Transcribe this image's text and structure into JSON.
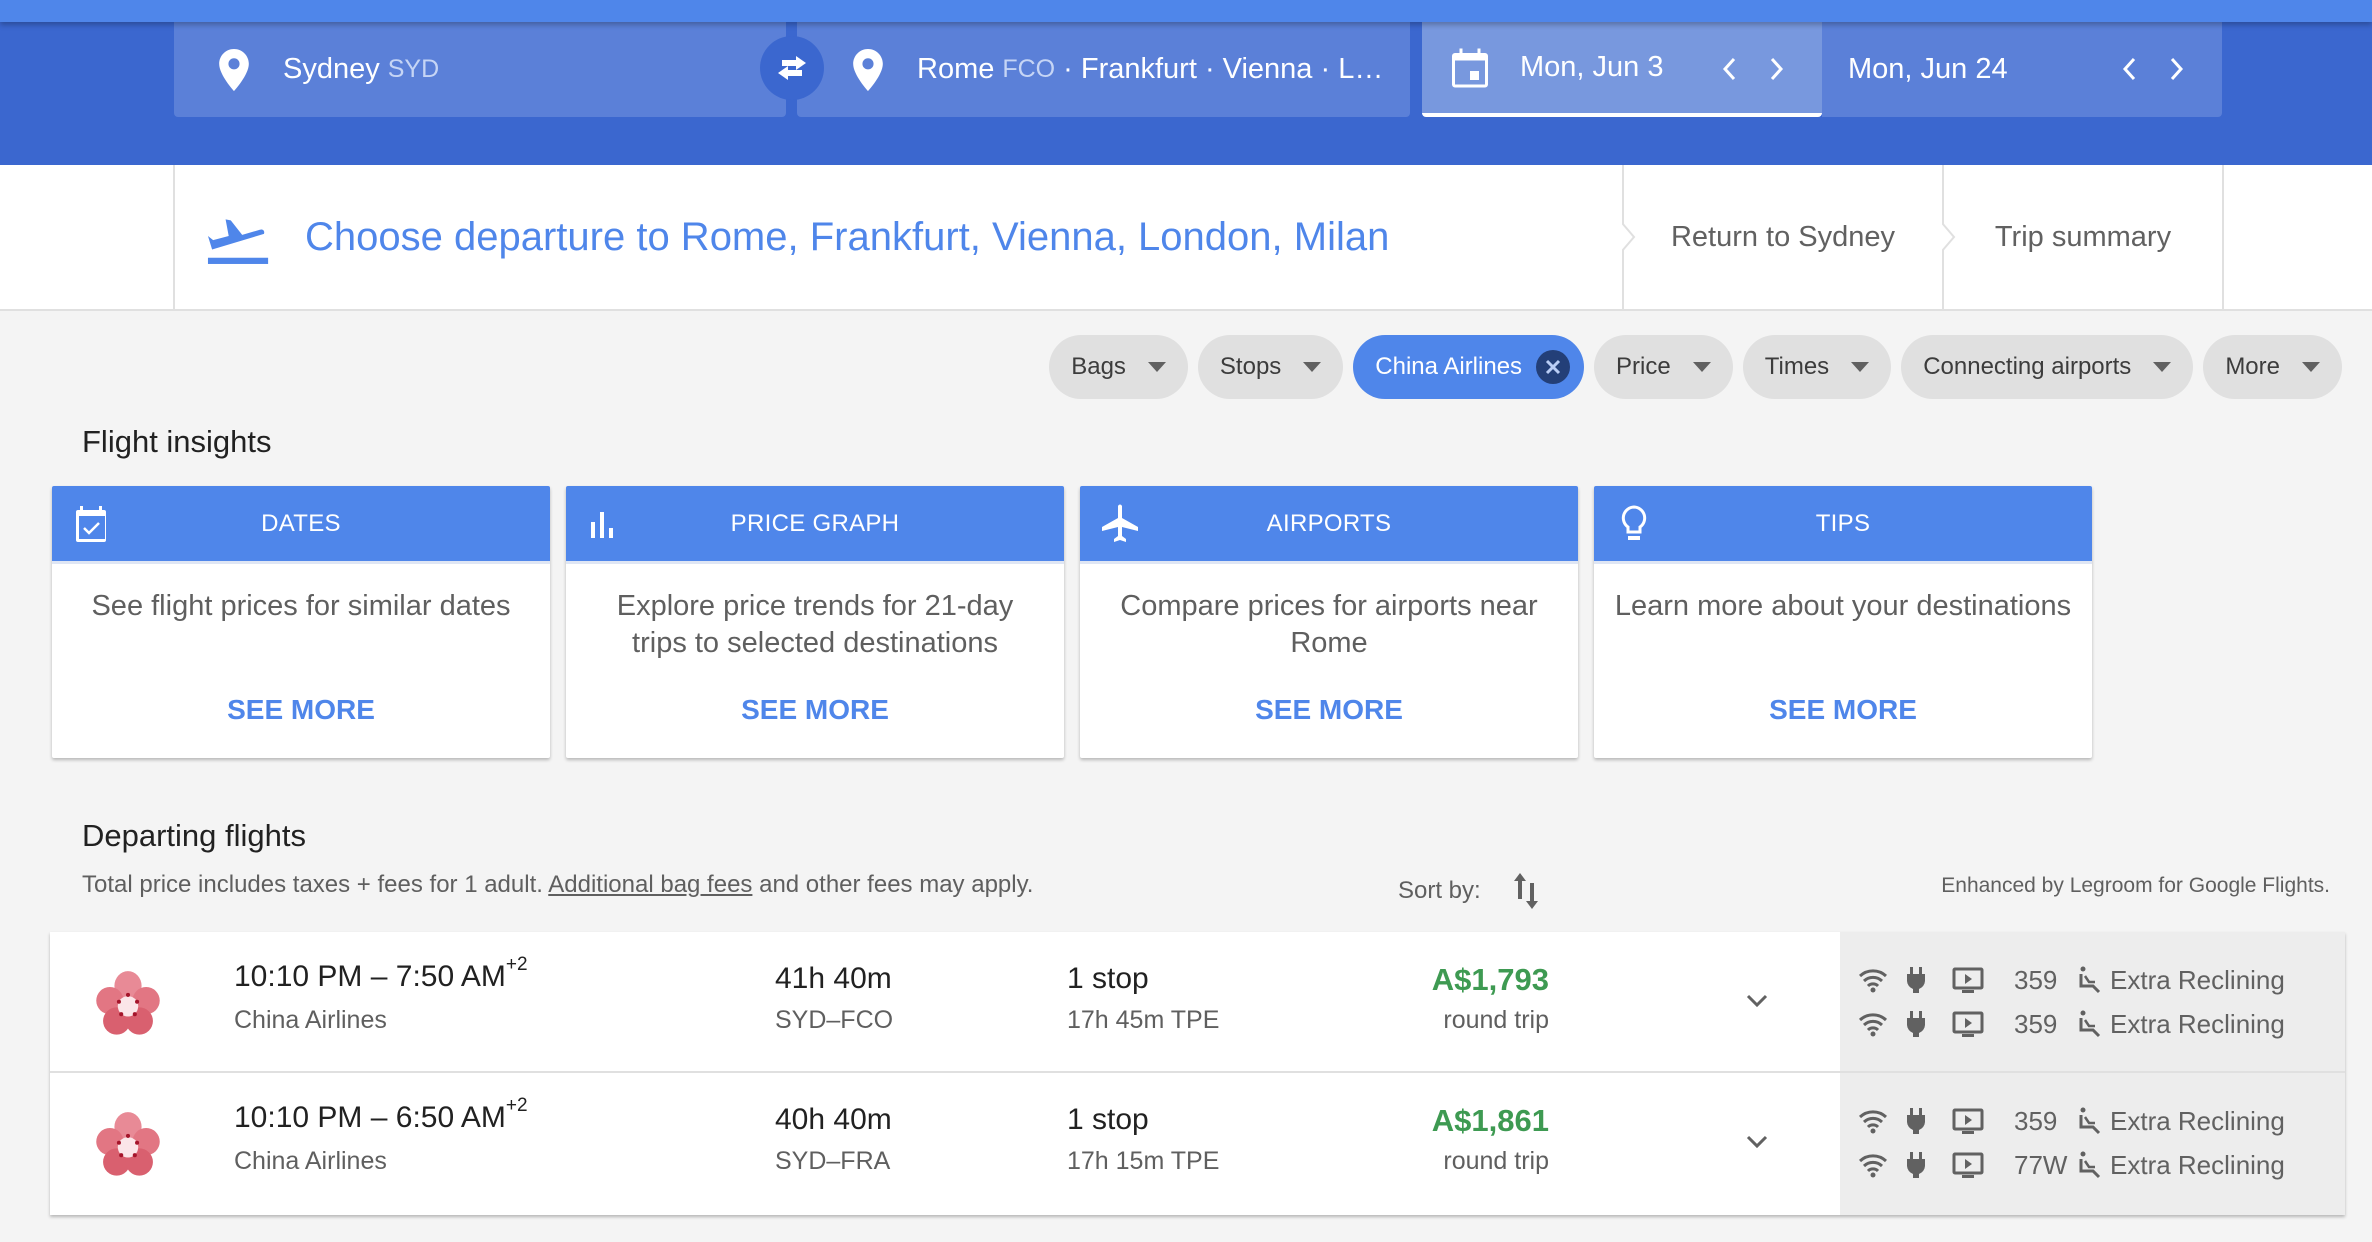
{
  "search": {
    "origin": {
      "city": "Sydney",
      "code": "SYD",
      "icon": "location-pin-icon"
    },
    "swap_icon": "swap-arrows-icon",
    "destination": {
      "city": "Rome",
      "code": "FCO",
      "rest": "· Frankfurt · Vienna · L…",
      "icon": "location-pin-icon"
    },
    "depart_date": {
      "label": "Mon, Jun 3",
      "icon": "calendar-icon",
      "prev_icon": "chevron-left-icon",
      "next_icon": "chevron-right-icon"
    },
    "return_date": {
      "label": "Mon, Jun 24",
      "prev_icon": "chevron-left-icon",
      "next_icon": "chevron-right-icon"
    }
  },
  "steps": {
    "current": {
      "label": "Choose departure to Rome, Frankfurt, Vienna, London, Milan",
      "icon": "flight-takeoff-icon"
    },
    "return": "Return to Sydney",
    "summary": "Trip summary"
  },
  "filters": [
    {
      "label": "Bags",
      "active": false
    },
    {
      "label": "Stops",
      "active": false
    },
    {
      "label": "China Airlines",
      "active": true
    },
    {
      "label": "Price",
      "active": false
    },
    {
      "label": "Times",
      "active": false
    },
    {
      "label": "Connecting airports",
      "active": false
    },
    {
      "label": "More",
      "active": false
    }
  ],
  "insights": {
    "title": "Flight insights",
    "cards": [
      {
        "title": "DATES",
        "icon": "calendar-check-icon",
        "text": "See flight prices for similar dates",
        "link": "SEE MORE"
      },
      {
        "title": "PRICE GRAPH",
        "icon": "bar-chart-icon",
        "text": "Explore price trends for 21-day trips to selected destinations",
        "link": "SEE MORE"
      },
      {
        "title": "AIRPORTS",
        "icon": "airplane-icon",
        "text": "Compare prices for airports near Rome",
        "link": "SEE MORE"
      },
      {
        "title": "TIPS",
        "icon": "lightbulb-icon",
        "text": "Learn more about your destinations",
        "link": "SEE MORE"
      }
    ]
  },
  "departing": {
    "title": "Departing flights",
    "subtitle_pre": "Total price includes taxes + fees for 1 adult.",
    "subtitle_link": "Additional bag fees",
    "subtitle_post": "and other fees may apply.",
    "sort_label": "Sort by:",
    "legroom_note": "Enhanced by Legroom for Google Flights.",
    "flights": [
      {
        "times": "10:10 PM – 7:50 AM",
        "day_offset": "+2",
        "airline": "China Airlines",
        "duration": "41h 40m",
        "route": "SYD–FCO",
        "stops": "1 stop",
        "layover": "17h 45m TPE",
        "price": "A$1,793",
        "price_type": "round trip",
        "amenities": [
          {
            "aircraft": "359",
            "seat": "Extra Reclining"
          },
          {
            "aircraft": "359",
            "seat": "Extra Reclining"
          }
        ]
      },
      {
        "times": "10:10 PM – 6:50 AM",
        "day_offset": "+2",
        "airline": "China Airlines",
        "duration": "40h 40m",
        "route": "SYD–FRA",
        "stops": "1 stop",
        "layover": "17h 15m TPE",
        "price": "A$1,861",
        "price_type": "round trip",
        "amenities": [
          {
            "aircraft": "359",
            "seat": "Extra Reclining"
          },
          {
            "aircraft": "77W",
            "seat": "Extra Reclining"
          }
        ]
      }
    ]
  },
  "colors": {
    "brand_blue": "#4f86ea",
    "header_blue": "#3b67cf",
    "price_green": "#3e9a52"
  }
}
